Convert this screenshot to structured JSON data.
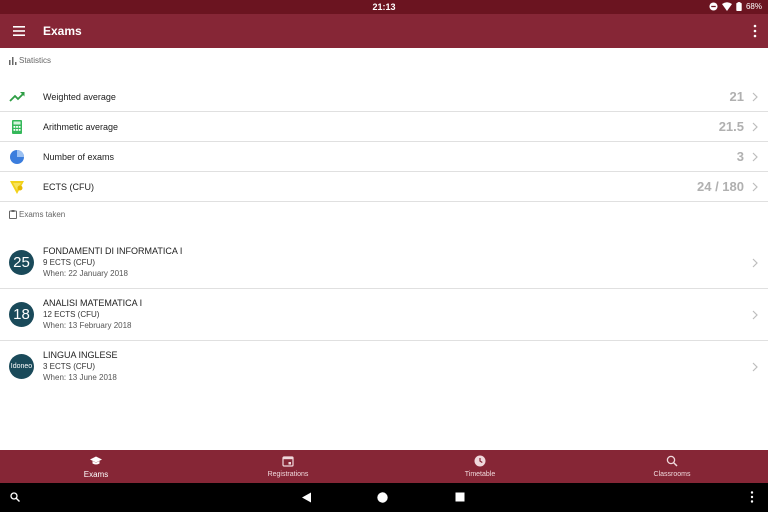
{
  "status_bar": {
    "time": "21:13",
    "battery": "68%"
  },
  "app_bar": {
    "title": "Exams"
  },
  "statistics": {
    "header": "Statistics",
    "rows": [
      {
        "label": "Weighted average",
        "value": "21",
        "icon": "trending-up-icon",
        "color": "#2e9e44"
      },
      {
        "label": "Arithmetic average",
        "value": "21.5",
        "icon": "calculator-icon",
        "color": "#35b85a"
      },
      {
        "label": "Number of exams",
        "value": "3",
        "icon": "pie-chart-icon",
        "color": "#3b7ddd"
      },
      {
        "label": "ECTS (CFU)",
        "value": "24 / 180",
        "icon": "badge-icon",
        "color": "#f2d21b"
      }
    ]
  },
  "exams": {
    "header": "Exams taken",
    "items": [
      {
        "grade": "25",
        "name": "FONDAMENTI DI INFORMATICA I",
        "ects": "9 ECTS (CFU)",
        "date": "When: 22 January 2018"
      },
      {
        "grade": "18",
        "name": "ANALISI MATEMATICA I",
        "ects": "12 ECTS (CFU)",
        "date": "When: 13 February 2018"
      },
      {
        "grade": "Idoneo",
        "name": "LINGUA INGLESE",
        "ects": "3 ECTS (CFU)",
        "date": "When: 13 June 2018"
      }
    ]
  },
  "bottom_nav": {
    "items": [
      {
        "label": "Exams",
        "icon": "graduation-cap-icon"
      },
      {
        "label": "Registrations",
        "icon": "calendar-icon"
      },
      {
        "label": "Timetable",
        "icon": "clock-icon"
      },
      {
        "label": "Classrooms",
        "icon": "search-icon"
      }
    ]
  },
  "colors": {
    "primary": "#862636",
    "status": "#6b1420",
    "avatar": "#1a4a5a",
    "value_gray": "#b0b0b0"
  }
}
